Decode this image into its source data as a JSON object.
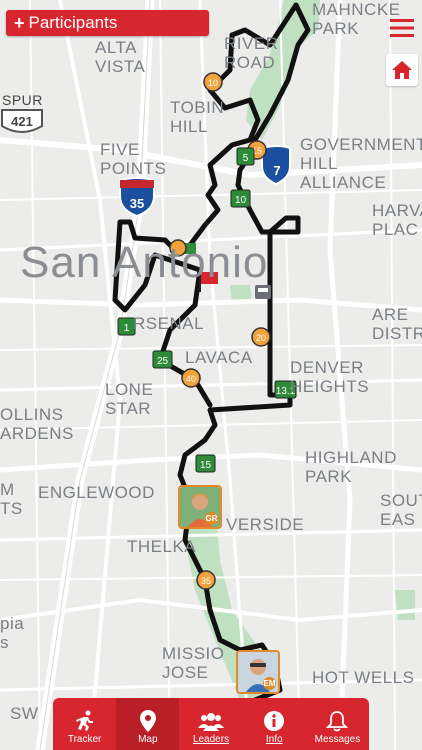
{
  "header": {
    "participants_label": "Participants"
  },
  "map_labels": [
    {
      "id": "mahncke-park",
      "text": "MAHNCKE\nPARK"
    },
    {
      "id": "alta-vista",
      "text": "ALTA\nVISTA"
    },
    {
      "id": "river-road",
      "text": "RIVER\nROAD"
    },
    {
      "id": "spur",
      "text": "SPUR"
    },
    {
      "id": "tobin-hill",
      "text": "TOBIN\nHILL"
    },
    {
      "id": "five-points",
      "text": "FIVE\nPOINTS"
    },
    {
      "id": "government-hill",
      "text": "GOVERNMENT\nHILL ALLIANCE"
    },
    {
      "id": "harvard-place",
      "text": "HARVA\nPLAC"
    },
    {
      "id": "san-antonio",
      "text": "San Antonio"
    },
    {
      "id": "arsenal",
      "text": "RSENAL"
    },
    {
      "id": "lavaca",
      "text": "LAVACA"
    },
    {
      "id": "area-distr",
      "text": "ARE\nDISTR"
    },
    {
      "id": "lone-star",
      "text": "LONE\nSTAR"
    },
    {
      "id": "denver-heights",
      "text": "DENVER\nHEIGHTS"
    },
    {
      "id": "collins-gardens",
      "text": "OLLINS\nARDENS"
    },
    {
      "id": "highland-park",
      "text": "HIGHLAND\nPARK"
    },
    {
      "id": "englewood",
      "text": "ENGLEWOOD"
    },
    {
      "id": "m-ts",
      "text": "M\nTS"
    },
    {
      "id": "south-east",
      "text": "SOUT\nEAS"
    },
    {
      "id": "riverside",
      "text": "VERSIDE"
    },
    {
      "id": "thelka",
      "text": "THELKA"
    },
    {
      "id": "pia",
      "text": "pia\ns"
    },
    {
      "id": "mission-jose",
      "text": "MISSIO\nJOSE"
    },
    {
      "id": "hot-wells",
      "text": "HOT WELLS"
    },
    {
      "id": "sw",
      "text": "SW"
    }
  ],
  "shields": {
    "spur_number": "421",
    "interstate": "35",
    "interstate_partial": "7"
  },
  "markers": {
    "orange": [
      "10",
      "15",
      "20",
      "35",
      "40"
    ],
    "green": [
      "1",
      "5",
      "10",
      "13.1",
      "15",
      "25"
    ]
  },
  "avatars": [
    {
      "initials": "GR"
    },
    {
      "initials": "EM"
    }
  ],
  "colors": {
    "accent": "#d7262e",
    "route": "#111111",
    "mile_orange": "#f3a13a",
    "mile_green": "#2e8b3a",
    "park": "#bfe1c1"
  },
  "tabs": [
    {
      "label": "Tracker",
      "icon": "runner-icon"
    },
    {
      "label": "Map",
      "icon": "map-pin-icon"
    },
    {
      "label": "Leaders",
      "icon": "group-icon"
    },
    {
      "label": "Info",
      "icon": "info-icon"
    },
    {
      "label": "Messages",
      "icon": "bell-icon"
    }
  ],
  "active_tab": "Map"
}
